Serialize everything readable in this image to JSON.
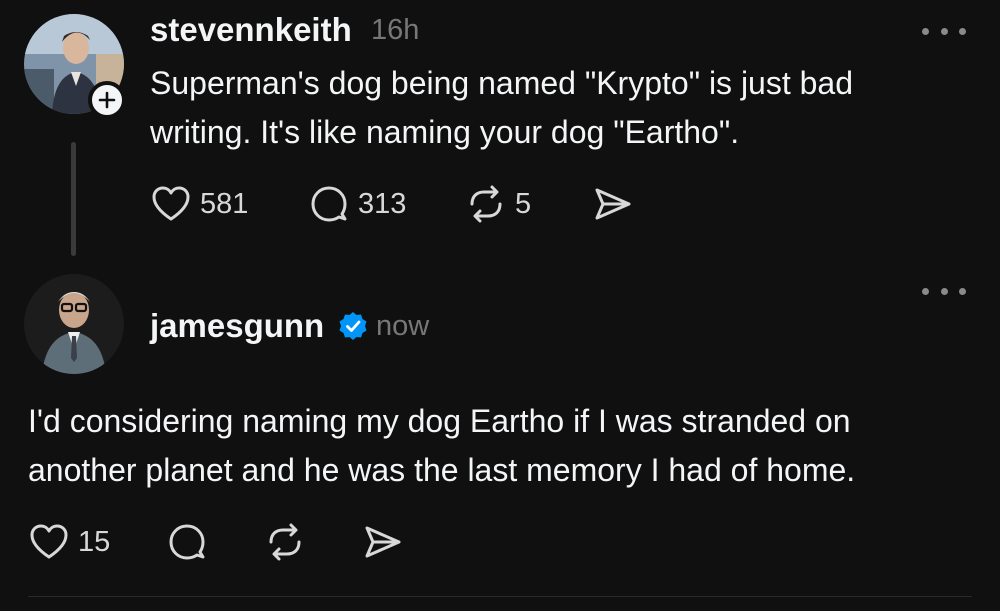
{
  "thread": {
    "original_post": {
      "username": "stevennkeith",
      "timestamp": "16h",
      "text_line1": "Superman's dog being named \"Krypto\" is just bad",
      "text_line2": "writing. It's like naming your dog \"Eartho\".",
      "likes": "581",
      "replies": "313",
      "reposts": "5",
      "follow_badge": "+"
    },
    "reply": {
      "username": "jamesgunn",
      "verified": true,
      "timestamp": "now",
      "text_line1": "I'd considering naming my dog Eartho if I was stranded on",
      "text_line2": "another planet and he was the last memory I had of home.",
      "likes": "15"
    }
  },
  "icons": {
    "like": "heart-icon",
    "reply": "speech-bubble-icon",
    "repost": "repost-icon",
    "share": "send-icon",
    "more": "ellipsis-icon",
    "verified": "verified-badge-icon"
  },
  "colors": {
    "background": "#101010",
    "text": "#f3f5f7",
    "secondary": "#777777",
    "verified": "#0095f6"
  }
}
